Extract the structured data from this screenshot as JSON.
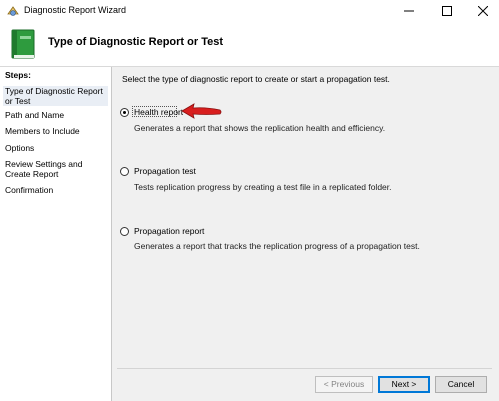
{
  "window": {
    "title": "Diagnostic Report Wizard",
    "icon": "app-wizard-icon",
    "controls": [
      "minimize-icon",
      "maximize-icon",
      "close-icon"
    ]
  },
  "header": {
    "icon": "green-book-icon",
    "title": "Type of Diagnostic Report or Test"
  },
  "sidebar": {
    "steps_label": "Steps:",
    "steps": [
      {
        "label": "Type of Diagnostic Report or Test",
        "active": true
      },
      {
        "label": "Path and Name",
        "active": false
      },
      {
        "label": "Members to Include",
        "active": false
      },
      {
        "label": "Options",
        "active": false
      },
      {
        "label": "Review Settings and Create Report",
        "active": false
      },
      {
        "label": "Confirmation",
        "active": false
      }
    ]
  },
  "main": {
    "instruction": "Select the type of diagnostic report to create or start a propagation test.",
    "options": [
      {
        "label": "Health report",
        "description": "Generates a report that shows the replication health and efficiency.",
        "checked": true
      },
      {
        "label": "Propagation test",
        "description": "Tests replication progress by creating a test file in a replicated folder.",
        "checked": false
      },
      {
        "label": "Propagation report",
        "description": "Generates a report that tracks the replication progress of a propagation test.",
        "checked": false
      }
    ],
    "annotation": "red-arrow-icon"
  },
  "buttons": {
    "previous": "< Previous",
    "next": "Next >",
    "cancel": "Cancel"
  },
  "colors": {
    "accent": "#0078d7",
    "arrow": "#d81e1e",
    "book": "#2e9b3e"
  }
}
